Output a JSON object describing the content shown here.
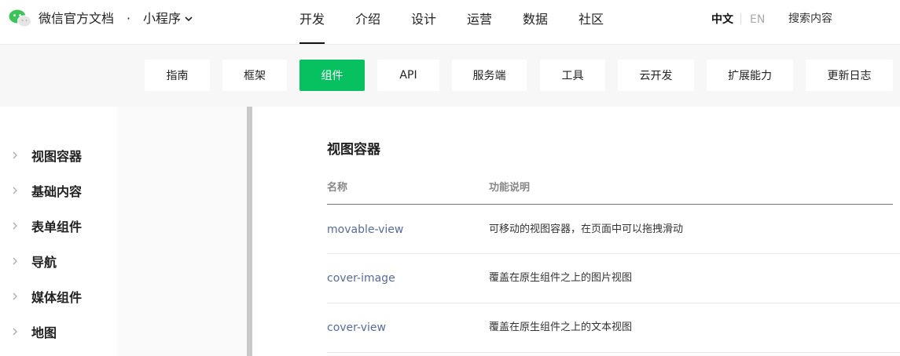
{
  "header": {
    "brand": "微信官方文档",
    "separator": "·",
    "product": "小程序",
    "nav": [
      {
        "label": "开发",
        "active": true
      },
      {
        "label": "介绍",
        "active": false
      },
      {
        "label": "设计",
        "active": false
      },
      {
        "label": "运营",
        "active": false
      },
      {
        "label": "数据",
        "active": false
      },
      {
        "label": "社区",
        "active": false
      }
    ],
    "lang_zh": "中文",
    "lang_en": "EN",
    "search_placeholder": "搜索内容"
  },
  "subnav": {
    "tabs": [
      {
        "label": "指南",
        "active": false
      },
      {
        "label": "框架",
        "active": false
      },
      {
        "label": "组件",
        "active": true
      },
      {
        "label": "API",
        "active": false
      },
      {
        "label": "服务端",
        "active": false
      },
      {
        "label": "工具",
        "active": false
      },
      {
        "label": "云开发",
        "active": false
      },
      {
        "label": "扩展能力",
        "active": false
      },
      {
        "label": "更新日志",
        "active": false
      }
    ]
  },
  "sidebar": {
    "items": [
      {
        "label": "视图容器"
      },
      {
        "label": "基础内容"
      },
      {
        "label": "表单组件"
      },
      {
        "label": "导航"
      },
      {
        "label": "媒体组件"
      },
      {
        "label": "地图"
      }
    ]
  },
  "main": {
    "title": "视图容器",
    "columns": [
      "名称",
      "功能说明"
    ],
    "rows": [
      {
        "name": "movable-view",
        "desc": "可移动的视图容器，在页面中可以拖拽滑动"
      },
      {
        "name": "cover-image",
        "desc": "覆盖在原生组件之上的图片视图"
      },
      {
        "name": "cover-view",
        "desc": "覆盖在原生组件之上的文本视图"
      }
    ]
  },
  "colors": {
    "accent": "#07c160",
    "link": "#576b95"
  }
}
